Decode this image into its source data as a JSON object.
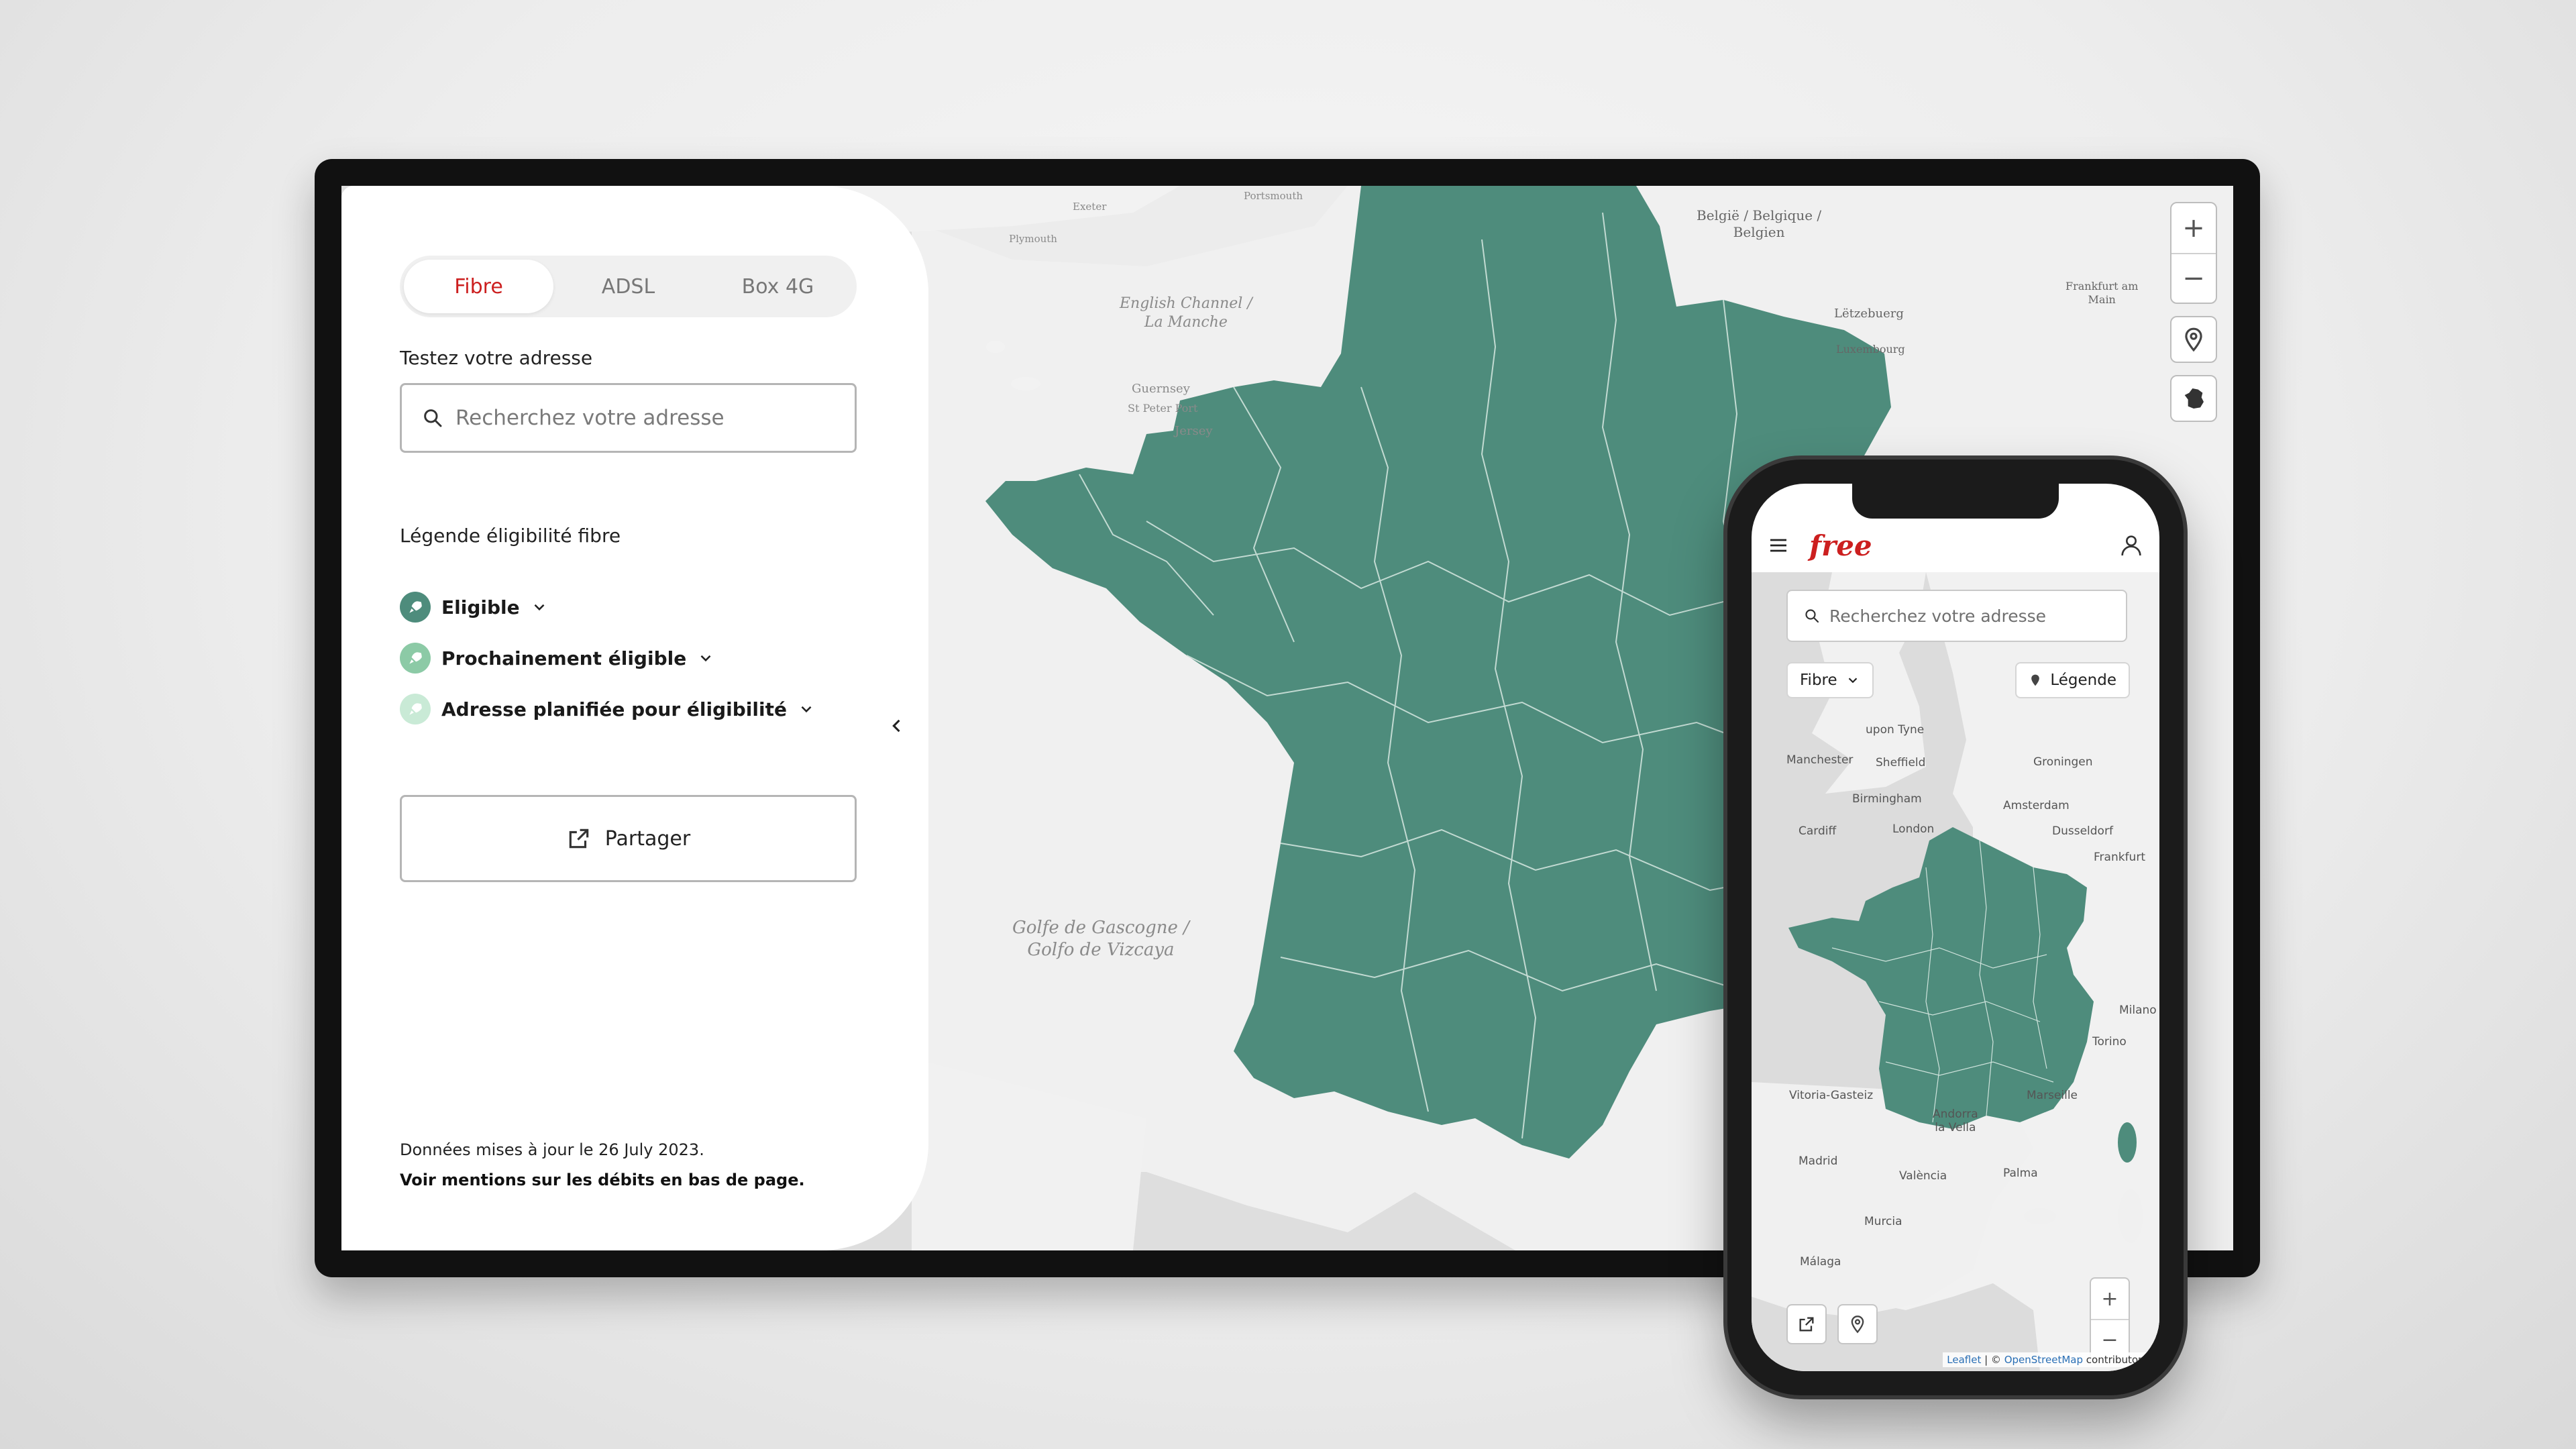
{
  "desktop": {
    "tabs": [
      {
        "label": "Fibre",
        "active": true
      },
      {
        "label": "ADSL",
        "active": false
      },
      {
        "label": "Box 4G",
        "active": false
      }
    ],
    "address_label": "Testez votre adresse",
    "search_placeholder": "Recherchez votre adresse",
    "legend_title": "Légende éligibilité fibre",
    "legend_items": [
      {
        "label": "Eligible",
        "color": "#4e8c7c"
      },
      {
        "label": "Prochainement éligible",
        "color": "#8ccaa6"
      },
      {
        "label": "Adresse planifiée pour éligibilité",
        "color": "#c9ead6"
      }
    ],
    "share_label": "Partager",
    "updated_text": "Données mises à jour le 26 July 2023.",
    "mentions_text": "Voir mentions sur les débits en bas de page.",
    "map_labels": {
      "gulf": "Golfe de Gascogne /\nGolfo de Vizcaya",
      "channel": "English Channel /\nLa Manche",
      "guernsey": "Guernsey",
      "st_peter_port": "St Peter Port",
      "jersey": "Jersey",
      "belgium": "België / Belgique /\nBelgien",
      "luxembourg": "Luxembourg",
      "letzebuerg": "Lëtzebuerg",
      "frankfurt": "Frankfurt am\nMain",
      "plymouth": "Plymouth",
      "exeter": "Exeter",
      "portsmouth": "Portsmouth"
    },
    "map_fill_color": "#4e8c7c"
  },
  "phone": {
    "brand": "free",
    "search_placeholder": "Recherchez votre adresse",
    "filter_label": "Fibre",
    "legend_label": "Légende",
    "map_labels": {
      "sheffield": "Sheffield",
      "manchester": "Manchester",
      "birmingham": "Birmingham",
      "london": "London",
      "cardiff": "Cardiff",
      "amsterdam": "Amsterdam",
      "groningen": "Groningen",
      "dusseldorf": "Dusseldorf",
      "frankfurt": "Frankfurt",
      "marseille": "Marseille",
      "madrid": "Madrid",
      "valencia": "València",
      "murcia": "Murcia",
      "malaga": "Málaga",
      "palma": "Palma",
      "andorra": "Andorra\nla Vella",
      "torino": "Torino",
      "milano": "Milano",
      "vitoria": "Vitoria-Gasteiz",
      "newcastle": "upon Tyne"
    },
    "attribution_leaflet": "Leaflet",
    "attribution_sep": " | © ",
    "attribution_osm": "OpenStreetMap",
    "attribution_tail": " contributors"
  }
}
